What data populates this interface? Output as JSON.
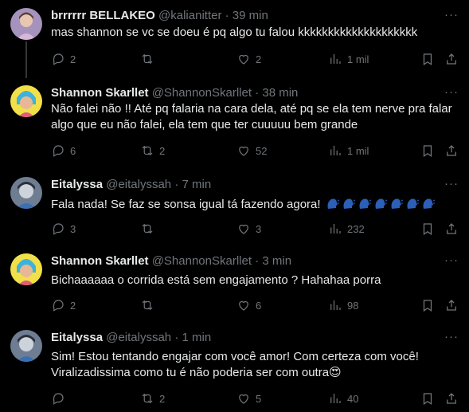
{
  "tweets": [
    {
      "name": "brrrrrr BELLAKEO",
      "handle": "@kalianitter",
      "time": "· 39 min",
      "text": "mas shannon se vc se doeu é pq algo tu falou kkkkkkkkkkkkkkkkkkkk",
      "replies": "2",
      "retweets": "",
      "likes": "2",
      "views": "1 mil",
      "avatar_color": "#b7a7c9"
    },
    {
      "name": "Shannon Skarllet",
      "handle": "@ShannonSkarllet",
      "time": "· 38 min",
      "text_lines": [
        "Não falei não !! Até pq falaria na cara dela, até pq se ela tem nerve pra falar",
        "algo que eu não falei, ela tem que ter cuuuuu bem grande"
      ],
      "replies": "6",
      "retweets": "2",
      "likes": "52",
      "views": "1 mil",
      "avatar_color": "#f2e04a"
    },
    {
      "name": "Eitalyssa",
      "handle": "@eitalyssah",
      "time": "· 7 min",
      "text": "Fala nada! Se faz se sonsa igual tá fazendo agora!",
      "emoji": "speaking-head-emoji x7",
      "replies": "3",
      "retweets": "",
      "likes": "3",
      "views": "232",
      "avatar_color": "#9aa6b8"
    },
    {
      "name": "Shannon Skarllet",
      "handle": "@ShannonSkarllet",
      "time": "· 3 min",
      "text": "Bichaaaaaa o corrida está sem engajamento ? Hahahaa porra",
      "replies": "2",
      "retweets": "",
      "likes": "6",
      "views": "98",
      "avatar_color": "#f2e04a"
    },
    {
      "name": "Eitalyssa",
      "handle": "@eitalyssah",
      "time": "· 1 min",
      "text_lines": [
        "Sim! Estou tentando engajar com você amor! Com certeza com você!",
        "Viralizadissima como tu é não poderia ser com outra😍"
      ],
      "replies": "",
      "retweets": "2",
      "likes": "5",
      "views": "40",
      "avatar_color": "#9aa6b8"
    }
  ],
  "more_label": "···",
  "icons": {
    "reply": "reply-icon",
    "retweet": "retweet-icon",
    "like": "heart-icon",
    "views": "views-icon",
    "bookmark": "bookmark-icon",
    "share": "share-icon"
  },
  "colors": {
    "background": "#000000",
    "text": "#e7e9ea",
    "muted": "#71767b",
    "line": "#333639"
  }
}
